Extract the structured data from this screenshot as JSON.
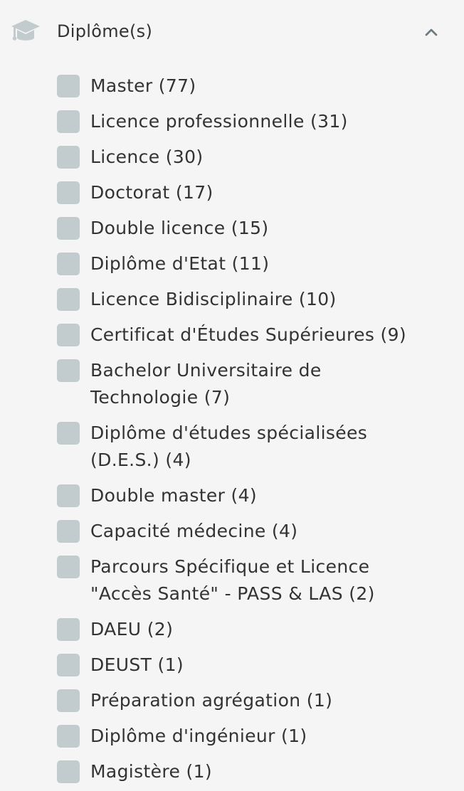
{
  "filter": {
    "icon": "graduation-cap-icon",
    "title": "Diplôme(s)",
    "toggle_icon": "chevron-up-icon",
    "colors": {
      "checkbox": "#c2ccce",
      "icon": "#c2ccce",
      "text": "#333333",
      "background": "#f5f5f5"
    },
    "options": [
      {
        "label": "Master (77)",
        "checked": false
      },
      {
        "label": "Licence professionnelle (31)",
        "checked": false
      },
      {
        "label": "Licence (30)",
        "checked": false
      },
      {
        "label": "Doctorat (17)",
        "checked": false
      },
      {
        "label": "Double licence (15)",
        "checked": false
      },
      {
        "label": "Diplôme d'Etat (11)",
        "checked": false
      },
      {
        "label": "Licence Bidisciplinaire (10)",
        "checked": false
      },
      {
        "label": "Certificat d'Études Supérieures (9)",
        "checked": false
      },
      {
        "label": "Bachelor Universitaire de\nTechnologie (7)",
        "checked": false
      },
      {
        "label": "Diplôme d'études spécialisées\n(D.E.S.) (4)",
        "checked": false
      },
      {
        "label": "Double master (4)",
        "checked": false
      },
      {
        "label": "Capacité médecine (4)",
        "checked": false
      },
      {
        "label": "Parcours Spécifique et Licence\n\"Accès Santé\" - PASS & LAS (2)",
        "checked": false
      },
      {
        "label": "DAEU (2)",
        "checked": false
      },
      {
        "label": "DEUST (1)",
        "checked": false
      },
      {
        "label": "Préparation agrégation (1)",
        "checked": false
      },
      {
        "label": "Diplôme d'ingénieur (1)",
        "checked": false
      },
      {
        "label": "Magistère (1)",
        "checked": false
      }
    ]
  }
}
